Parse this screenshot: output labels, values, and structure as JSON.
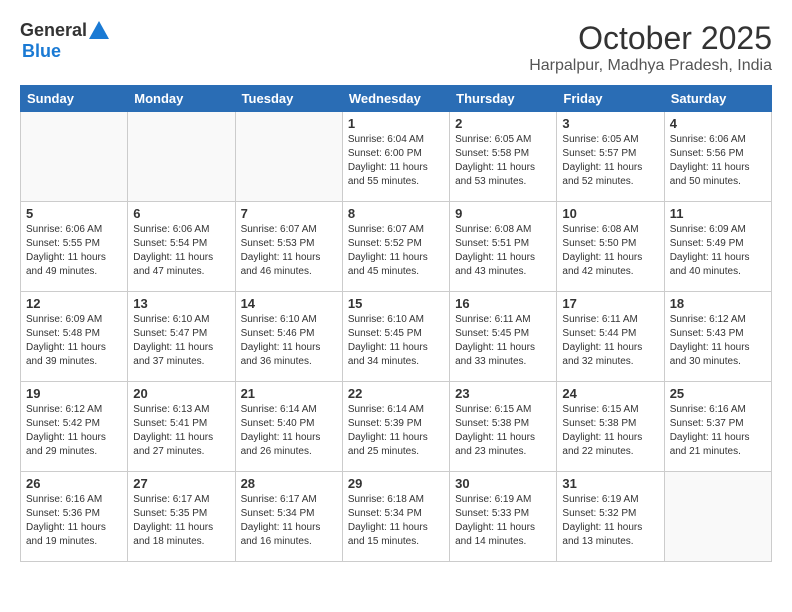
{
  "header": {
    "logo": {
      "general": "General",
      "blue": "Blue"
    },
    "title": "October 2025",
    "location": "Harpalpur, Madhya Pradesh, India"
  },
  "weekdays": [
    "Sunday",
    "Monday",
    "Tuesday",
    "Wednesday",
    "Thursday",
    "Friday",
    "Saturday"
  ],
  "weeks": [
    [
      {
        "day": "",
        "info": ""
      },
      {
        "day": "",
        "info": ""
      },
      {
        "day": "",
        "info": ""
      },
      {
        "day": "1",
        "info": "Sunrise: 6:04 AM\nSunset: 6:00 PM\nDaylight: 11 hours\nand 55 minutes."
      },
      {
        "day": "2",
        "info": "Sunrise: 6:05 AM\nSunset: 5:58 PM\nDaylight: 11 hours\nand 53 minutes."
      },
      {
        "day": "3",
        "info": "Sunrise: 6:05 AM\nSunset: 5:57 PM\nDaylight: 11 hours\nand 52 minutes."
      },
      {
        "day": "4",
        "info": "Sunrise: 6:06 AM\nSunset: 5:56 PM\nDaylight: 11 hours\nand 50 minutes."
      }
    ],
    [
      {
        "day": "5",
        "info": "Sunrise: 6:06 AM\nSunset: 5:55 PM\nDaylight: 11 hours\nand 49 minutes."
      },
      {
        "day": "6",
        "info": "Sunrise: 6:06 AM\nSunset: 5:54 PM\nDaylight: 11 hours\nand 47 minutes."
      },
      {
        "day": "7",
        "info": "Sunrise: 6:07 AM\nSunset: 5:53 PM\nDaylight: 11 hours\nand 46 minutes."
      },
      {
        "day": "8",
        "info": "Sunrise: 6:07 AM\nSunset: 5:52 PM\nDaylight: 11 hours\nand 45 minutes."
      },
      {
        "day": "9",
        "info": "Sunrise: 6:08 AM\nSunset: 5:51 PM\nDaylight: 11 hours\nand 43 minutes."
      },
      {
        "day": "10",
        "info": "Sunrise: 6:08 AM\nSunset: 5:50 PM\nDaylight: 11 hours\nand 42 minutes."
      },
      {
        "day": "11",
        "info": "Sunrise: 6:09 AM\nSunset: 5:49 PM\nDaylight: 11 hours\nand 40 minutes."
      }
    ],
    [
      {
        "day": "12",
        "info": "Sunrise: 6:09 AM\nSunset: 5:48 PM\nDaylight: 11 hours\nand 39 minutes."
      },
      {
        "day": "13",
        "info": "Sunrise: 6:10 AM\nSunset: 5:47 PM\nDaylight: 11 hours\nand 37 minutes."
      },
      {
        "day": "14",
        "info": "Sunrise: 6:10 AM\nSunset: 5:46 PM\nDaylight: 11 hours\nand 36 minutes."
      },
      {
        "day": "15",
        "info": "Sunrise: 6:10 AM\nSunset: 5:45 PM\nDaylight: 11 hours\nand 34 minutes."
      },
      {
        "day": "16",
        "info": "Sunrise: 6:11 AM\nSunset: 5:45 PM\nDaylight: 11 hours\nand 33 minutes."
      },
      {
        "day": "17",
        "info": "Sunrise: 6:11 AM\nSunset: 5:44 PM\nDaylight: 11 hours\nand 32 minutes."
      },
      {
        "day": "18",
        "info": "Sunrise: 6:12 AM\nSunset: 5:43 PM\nDaylight: 11 hours\nand 30 minutes."
      }
    ],
    [
      {
        "day": "19",
        "info": "Sunrise: 6:12 AM\nSunset: 5:42 PM\nDaylight: 11 hours\nand 29 minutes."
      },
      {
        "day": "20",
        "info": "Sunrise: 6:13 AM\nSunset: 5:41 PM\nDaylight: 11 hours\nand 27 minutes."
      },
      {
        "day": "21",
        "info": "Sunrise: 6:14 AM\nSunset: 5:40 PM\nDaylight: 11 hours\nand 26 minutes."
      },
      {
        "day": "22",
        "info": "Sunrise: 6:14 AM\nSunset: 5:39 PM\nDaylight: 11 hours\nand 25 minutes."
      },
      {
        "day": "23",
        "info": "Sunrise: 6:15 AM\nSunset: 5:38 PM\nDaylight: 11 hours\nand 23 minutes."
      },
      {
        "day": "24",
        "info": "Sunrise: 6:15 AM\nSunset: 5:38 PM\nDaylight: 11 hours\nand 22 minutes."
      },
      {
        "day": "25",
        "info": "Sunrise: 6:16 AM\nSunset: 5:37 PM\nDaylight: 11 hours\nand 21 minutes."
      }
    ],
    [
      {
        "day": "26",
        "info": "Sunrise: 6:16 AM\nSunset: 5:36 PM\nDaylight: 11 hours\nand 19 minutes."
      },
      {
        "day": "27",
        "info": "Sunrise: 6:17 AM\nSunset: 5:35 PM\nDaylight: 11 hours\nand 18 minutes."
      },
      {
        "day": "28",
        "info": "Sunrise: 6:17 AM\nSunset: 5:34 PM\nDaylight: 11 hours\nand 16 minutes."
      },
      {
        "day": "29",
        "info": "Sunrise: 6:18 AM\nSunset: 5:34 PM\nDaylight: 11 hours\nand 15 minutes."
      },
      {
        "day": "30",
        "info": "Sunrise: 6:19 AM\nSunset: 5:33 PM\nDaylight: 11 hours\nand 14 minutes."
      },
      {
        "day": "31",
        "info": "Sunrise: 6:19 AM\nSunset: 5:32 PM\nDaylight: 11 hours\nand 13 minutes."
      },
      {
        "day": "",
        "info": ""
      }
    ]
  ]
}
